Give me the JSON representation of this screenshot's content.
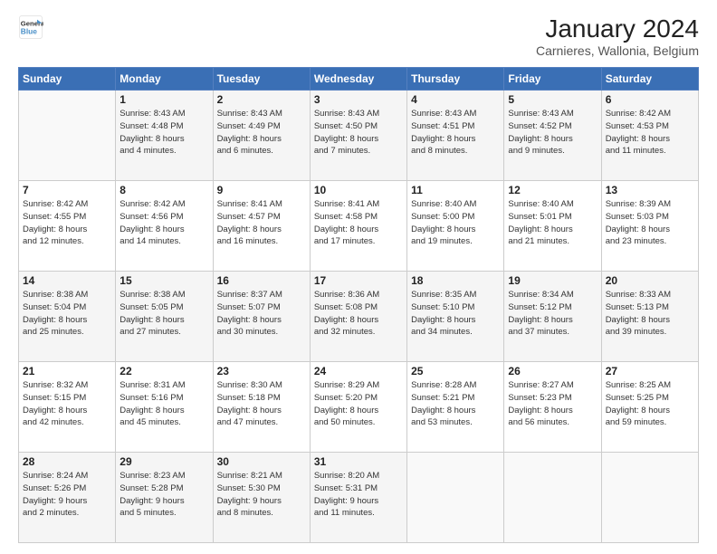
{
  "logo": {
    "line1": "General",
    "line2": "Blue"
  },
  "title": "January 2024",
  "subtitle": "Carnieres, Wallonia, Belgium",
  "header_days": [
    "Sunday",
    "Monday",
    "Tuesday",
    "Wednesday",
    "Thursday",
    "Friday",
    "Saturday"
  ],
  "weeks": [
    [
      {
        "day": "",
        "info": ""
      },
      {
        "day": "1",
        "info": "Sunrise: 8:43 AM\nSunset: 4:48 PM\nDaylight: 8 hours\nand 4 minutes."
      },
      {
        "day": "2",
        "info": "Sunrise: 8:43 AM\nSunset: 4:49 PM\nDaylight: 8 hours\nand 6 minutes."
      },
      {
        "day": "3",
        "info": "Sunrise: 8:43 AM\nSunset: 4:50 PM\nDaylight: 8 hours\nand 7 minutes."
      },
      {
        "day": "4",
        "info": "Sunrise: 8:43 AM\nSunset: 4:51 PM\nDaylight: 8 hours\nand 8 minutes."
      },
      {
        "day": "5",
        "info": "Sunrise: 8:43 AM\nSunset: 4:52 PM\nDaylight: 8 hours\nand 9 minutes."
      },
      {
        "day": "6",
        "info": "Sunrise: 8:42 AM\nSunset: 4:53 PM\nDaylight: 8 hours\nand 11 minutes."
      }
    ],
    [
      {
        "day": "7",
        "info": "Sunrise: 8:42 AM\nSunset: 4:55 PM\nDaylight: 8 hours\nand 12 minutes."
      },
      {
        "day": "8",
        "info": "Sunrise: 8:42 AM\nSunset: 4:56 PM\nDaylight: 8 hours\nand 14 minutes."
      },
      {
        "day": "9",
        "info": "Sunrise: 8:41 AM\nSunset: 4:57 PM\nDaylight: 8 hours\nand 16 minutes."
      },
      {
        "day": "10",
        "info": "Sunrise: 8:41 AM\nSunset: 4:58 PM\nDaylight: 8 hours\nand 17 minutes."
      },
      {
        "day": "11",
        "info": "Sunrise: 8:40 AM\nSunset: 5:00 PM\nDaylight: 8 hours\nand 19 minutes."
      },
      {
        "day": "12",
        "info": "Sunrise: 8:40 AM\nSunset: 5:01 PM\nDaylight: 8 hours\nand 21 minutes."
      },
      {
        "day": "13",
        "info": "Sunrise: 8:39 AM\nSunset: 5:03 PM\nDaylight: 8 hours\nand 23 minutes."
      }
    ],
    [
      {
        "day": "14",
        "info": "Sunrise: 8:38 AM\nSunset: 5:04 PM\nDaylight: 8 hours\nand 25 minutes."
      },
      {
        "day": "15",
        "info": "Sunrise: 8:38 AM\nSunset: 5:05 PM\nDaylight: 8 hours\nand 27 minutes."
      },
      {
        "day": "16",
        "info": "Sunrise: 8:37 AM\nSunset: 5:07 PM\nDaylight: 8 hours\nand 30 minutes."
      },
      {
        "day": "17",
        "info": "Sunrise: 8:36 AM\nSunset: 5:08 PM\nDaylight: 8 hours\nand 32 minutes."
      },
      {
        "day": "18",
        "info": "Sunrise: 8:35 AM\nSunset: 5:10 PM\nDaylight: 8 hours\nand 34 minutes."
      },
      {
        "day": "19",
        "info": "Sunrise: 8:34 AM\nSunset: 5:12 PM\nDaylight: 8 hours\nand 37 minutes."
      },
      {
        "day": "20",
        "info": "Sunrise: 8:33 AM\nSunset: 5:13 PM\nDaylight: 8 hours\nand 39 minutes."
      }
    ],
    [
      {
        "day": "21",
        "info": "Sunrise: 8:32 AM\nSunset: 5:15 PM\nDaylight: 8 hours\nand 42 minutes."
      },
      {
        "day": "22",
        "info": "Sunrise: 8:31 AM\nSunset: 5:16 PM\nDaylight: 8 hours\nand 45 minutes."
      },
      {
        "day": "23",
        "info": "Sunrise: 8:30 AM\nSunset: 5:18 PM\nDaylight: 8 hours\nand 47 minutes."
      },
      {
        "day": "24",
        "info": "Sunrise: 8:29 AM\nSunset: 5:20 PM\nDaylight: 8 hours\nand 50 minutes."
      },
      {
        "day": "25",
        "info": "Sunrise: 8:28 AM\nSunset: 5:21 PM\nDaylight: 8 hours\nand 53 minutes."
      },
      {
        "day": "26",
        "info": "Sunrise: 8:27 AM\nSunset: 5:23 PM\nDaylight: 8 hours\nand 56 minutes."
      },
      {
        "day": "27",
        "info": "Sunrise: 8:25 AM\nSunset: 5:25 PM\nDaylight: 8 hours\nand 59 minutes."
      }
    ],
    [
      {
        "day": "28",
        "info": "Sunrise: 8:24 AM\nSunset: 5:26 PM\nDaylight: 9 hours\nand 2 minutes."
      },
      {
        "day": "29",
        "info": "Sunrise: 8:23 AM\nSunset: 5:28 PM\nDaylight: 9 hours\nand 5 minutes."
      },
      {
        "day": "30",
        "info": "Sunrise: 8:21 AM\nSunset: 5:30 PM\nDaylight: 9 hours\nand 8 minutes."
      },
      {
        "day": "31",
        "info": "Sunrise: 8:20 AM\nSunset: 5:31 PM\nDaylight: 9 hours\nand 11 minutes."
      },
      {
        "day": "",
        "info": ""
      },
      {
        "day": "",
        "info": ""
      },
      {
        "day": "",
        "info": ""
      }
    ]
  ]
}
